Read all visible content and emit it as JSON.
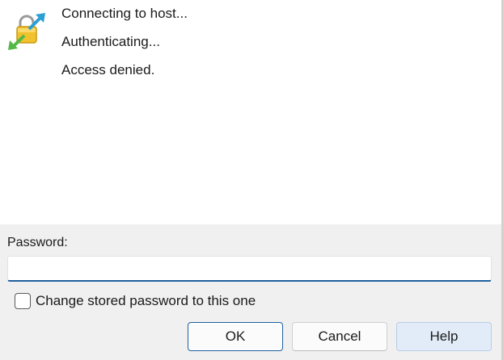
{
  "log": {
    "lines": [
      "Connecting to host...",
      "Authenticating...",
      "Access denied."
    ],
    "icon": "lock-transfer-icon"
  },
  "password": {
    "label": "Password:",
    "value": "",
    "placeholder": ""
  },
  "change_stored": {
    "label": "Change stored password to this one",
    "checked": false
  },
  "buttons": {
    "ok": "OK",
    "cancel": "Cancel",
    "help": "Help"
  },
  "colors": {
    "focus_accent": "#1f5f9e",
    "panel_bg": "#f0f0f0",
    "help_bg": "#e1ecf8"
  }
}
